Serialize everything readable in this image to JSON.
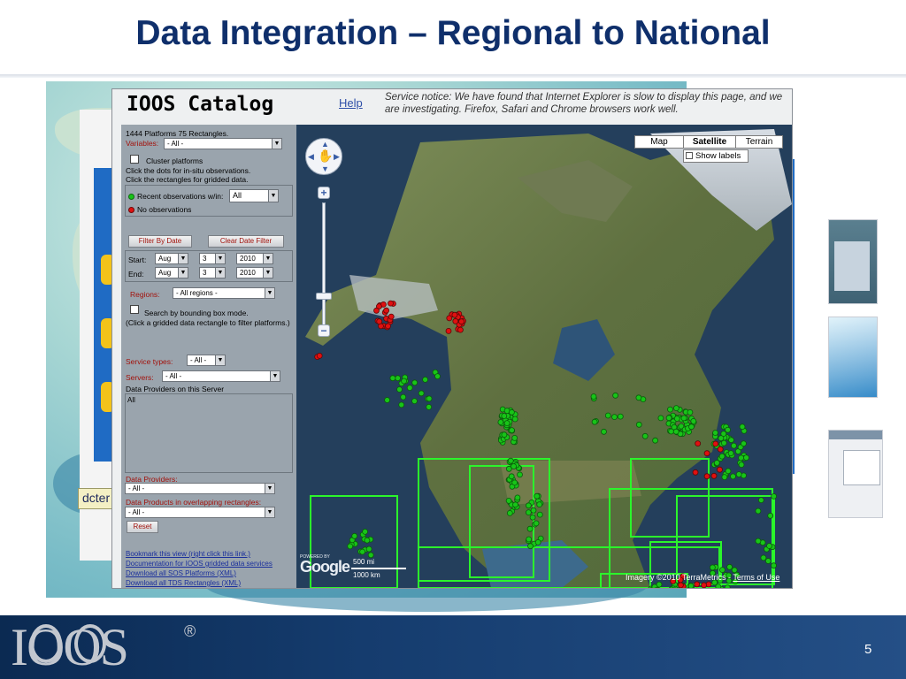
{
  "slide": {
    "title": "Data Integration – Regional to National",
    "page_number": "5",
    "background_label": "dcter"
  },
  "logo": {
    "text": "IOOS",
    "registered": "®"
  },
  "catalog": {
    "title": "IOOS Catalog",
    "help_link": "Help",
    "notice": "Service notice: We have found that Internet Explorer is slow to display this page, and we are investigating. Firefox, Safari and Chrome browsers work well."
  },
  "sidebar": {
    "summary": "1444 Platforms 75 Rectangles.",
    "variables_label": "Variables:",
    "variables_value": "- All -",
    "cluster_label": "Cluster platforms",
    "hint_dots": "Click the dots for in-situ observations.",
    "hint_rects": "Click the rectangles for gridded data.",
    "legend_recent": "Recent observations w/in:",
    "legend_recent_value": "All",
    "legend_none": "No observations",
    "filter_btn": "Filter By Date",
    "clear_btn": "Clear Date Filter",
    "start_label": "Start:",
    "end_label": "End:",
    "start": {
      "month": "Aug",
      "day": "3",
      "year": "2010"
    },
    "end": {
      "month": "Aug",
      "day": "3",
      "year": "2010"
    },
    "regions_label": "Regions:",
    "regions_value": "- All regions -",
    "bbox_label": "Search by bounding box mode.",
    "bbox_hint": "(Click a gridded data rectangle to filter platforms.)",
    "service_label": "Service types:",
    "service_value": "- All -",
    "servers_label": "Servers:",
    "servers_value": "- All -",
    "providers_server_label": "Data Providers on this Server",
    "providers_server_value": "All",
    "providers_label": "Data Providers:",
    "providers_value": "- All -",
    "products_label": "Data Products in overlapping rectangles:",
    "products_value": "- All -",
    "reset_btn": "Reset",
    "links": [
      "Bookmark this view (right click this link.)",
      "Documentation for IOOS gridded data services",
      "Download all SOS Platforms (XML)",
      "Download all TDS Rectangles (XML)"
    ]
  },
  "map": {
    "buttons": [
      "Map",
      "Satellite",
      "Terrain"
    ],
    "active_button": "Satellite",
    "show_labels": "Show labels",
    "powered_by": "POWERED BY",
    "google": "Google",
    "scale_top": "500 mi",
    "scale_bottom": "1000 km",
    "imagery": "Imagery ©2010 TerraMetrics -",
    "terms": "Terms of Use"
  },
  "colors": {
    "title": "#0f2f6b",
    "marker_recent": "#18c418",
    "marker_none": "#e01010",
    "rect": "#2bf52b",
    "label_red": "#a2120c"
  }
}
